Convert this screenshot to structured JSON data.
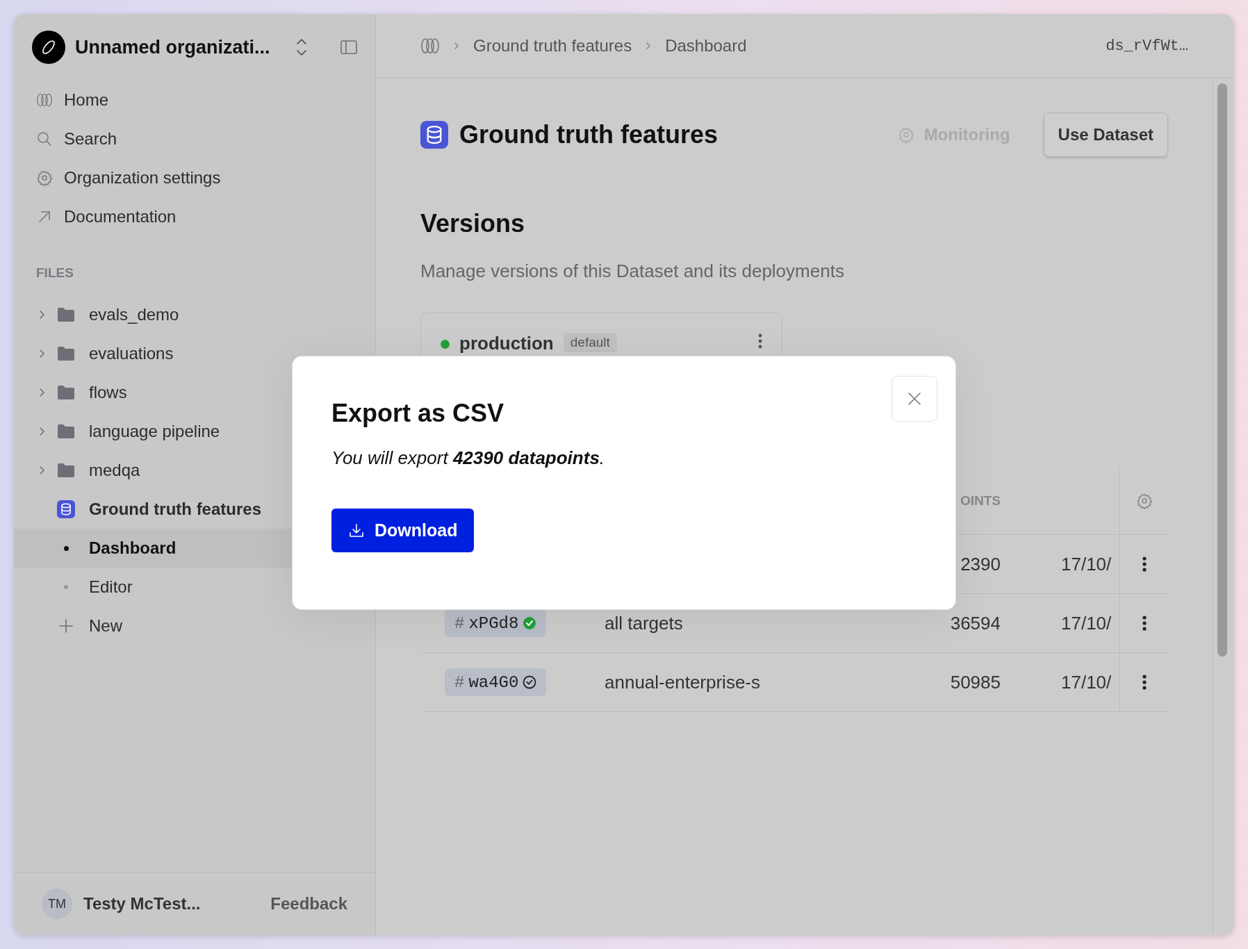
{
  "sidebar": {
    "organization": {
      "name": "Unnamed organizati..."
    },
    "nav": [
      {
        "kind": "home",
        "label": "Home"
      },
      {
        "kind": "search",
        "label": "Search"
      },
      {
        "kind": "settings",
        "label": "Organization settings"
      },
      {
        "kind": "external",
        "label": "Documentation"
      }
    ],
    "files_heading": "FILES",
    "files": [
      {
        "kind": "folder",
        "label": "evals_demo",
        "expanded": false
      },
      {
        "kind": "folder",
        "label": "evaluations",
        "expanded": false
      },
      {
        "kind": "folder",
        "label": "flows",
        "expanded": false
      },
      {
        "kind": "folder",
        "label": "language pipeline",
        "expanded": false
      },
      {
        "kind": "folder",
        "label": "medqa",
        "expanded": false
      },
      {
        "kind": "dataset",
        "label": "Ground truth features",
        "children": [
          {
            "kind": "page",
            "label": "Dashboard",
            "selected": true
          },
          {
            "kind": "page",
            "label": "Editor",
            "selected": false
          },
          {
            "kind": "new",
            "label": "New"
          }
        ]
      }
    ],
    "user": {
      "initials": "TM",
      "name": "Testy McTest..."
    },
    "feedback": "Feedback"
  },
  "breadcrumb": [
    "Ground truth features",
    "Dashboard"
  ],
  "dataset_id": "ds_rVfWt…",
  "page": {
    "title": "Ground truth features",
    "monitoring": {
      "label": "Monitoring",
      "disabled": true
    },
    "use_button": "Use Dataset",
    "versions": {
      "heading": "Versions",
      "description": "Manage versions of this Dataset and its deployments",
      "card": {
        "name": "production",
        "badge": "default"
      },
      "table": {
        "columns": {
          "column_3": "OINTS"
        },
        "rows": [
          {
            "count": "2390",
            "date": "17/10/"
          },
          {
            "prefix": "#",
            "version": "xPGd8",
            "verified": true,
            "name": "all targets",
            "count": "36594",
            "date": "17/10/"
          },
          {
            "prefix": "#",
            "version": "wa4G0",
            "verified": false,
            "name": "annual-enterprise-s",
            "count": "50985",
            "date": "17/10/"
          }
        ]
      }
    }
  },
  "dialog": {
    "title": "Export as CSV",
    "message": "You will export **42390 datapoints**.",
    "button": "Download"
  }
}
